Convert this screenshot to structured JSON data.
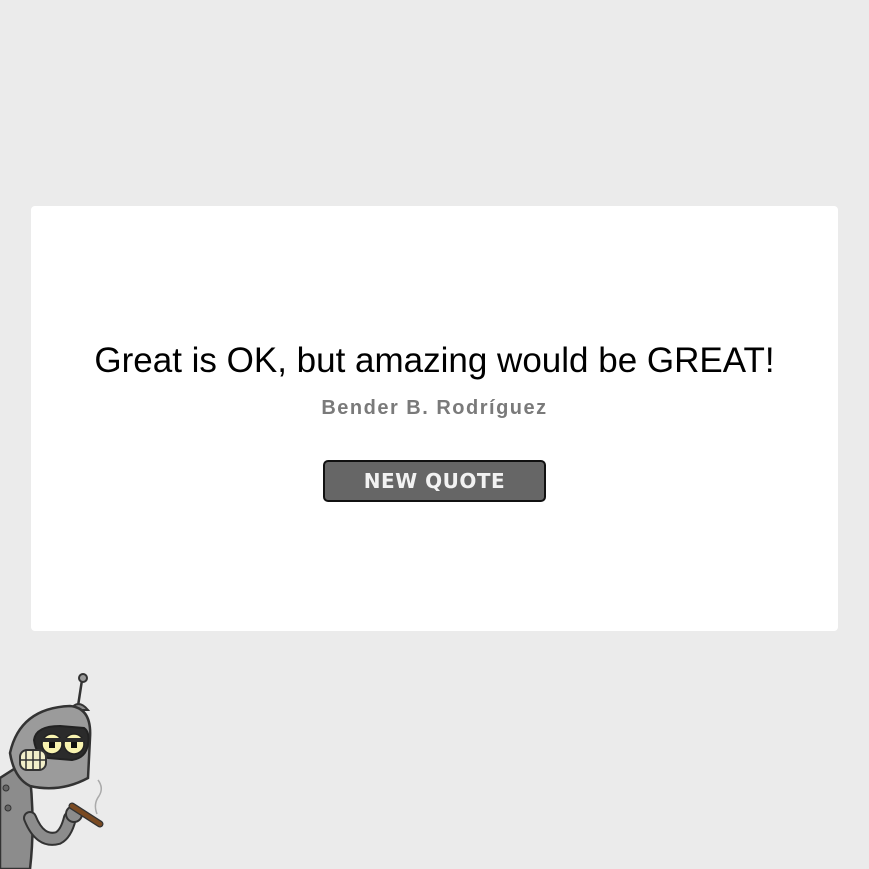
{
  "quote": {
    "text": "Great is OK, but amazing would be GREAT!",
    "author": "Bender B. Rodríguez"
  },
  "actions": {
    "new_quote_label": "NEW QUOTE"
  },
  "colors": {
    "page_background": "#ebebeb",
    "card_background": "#ffffff",
    "author_text": "#7a7a7a",
    "button_background": "#666666",
    "button_text": "#f2f2f2"
  },
  "decoration": {
    "character_icon": "bender-robot-icon"
  }
}
